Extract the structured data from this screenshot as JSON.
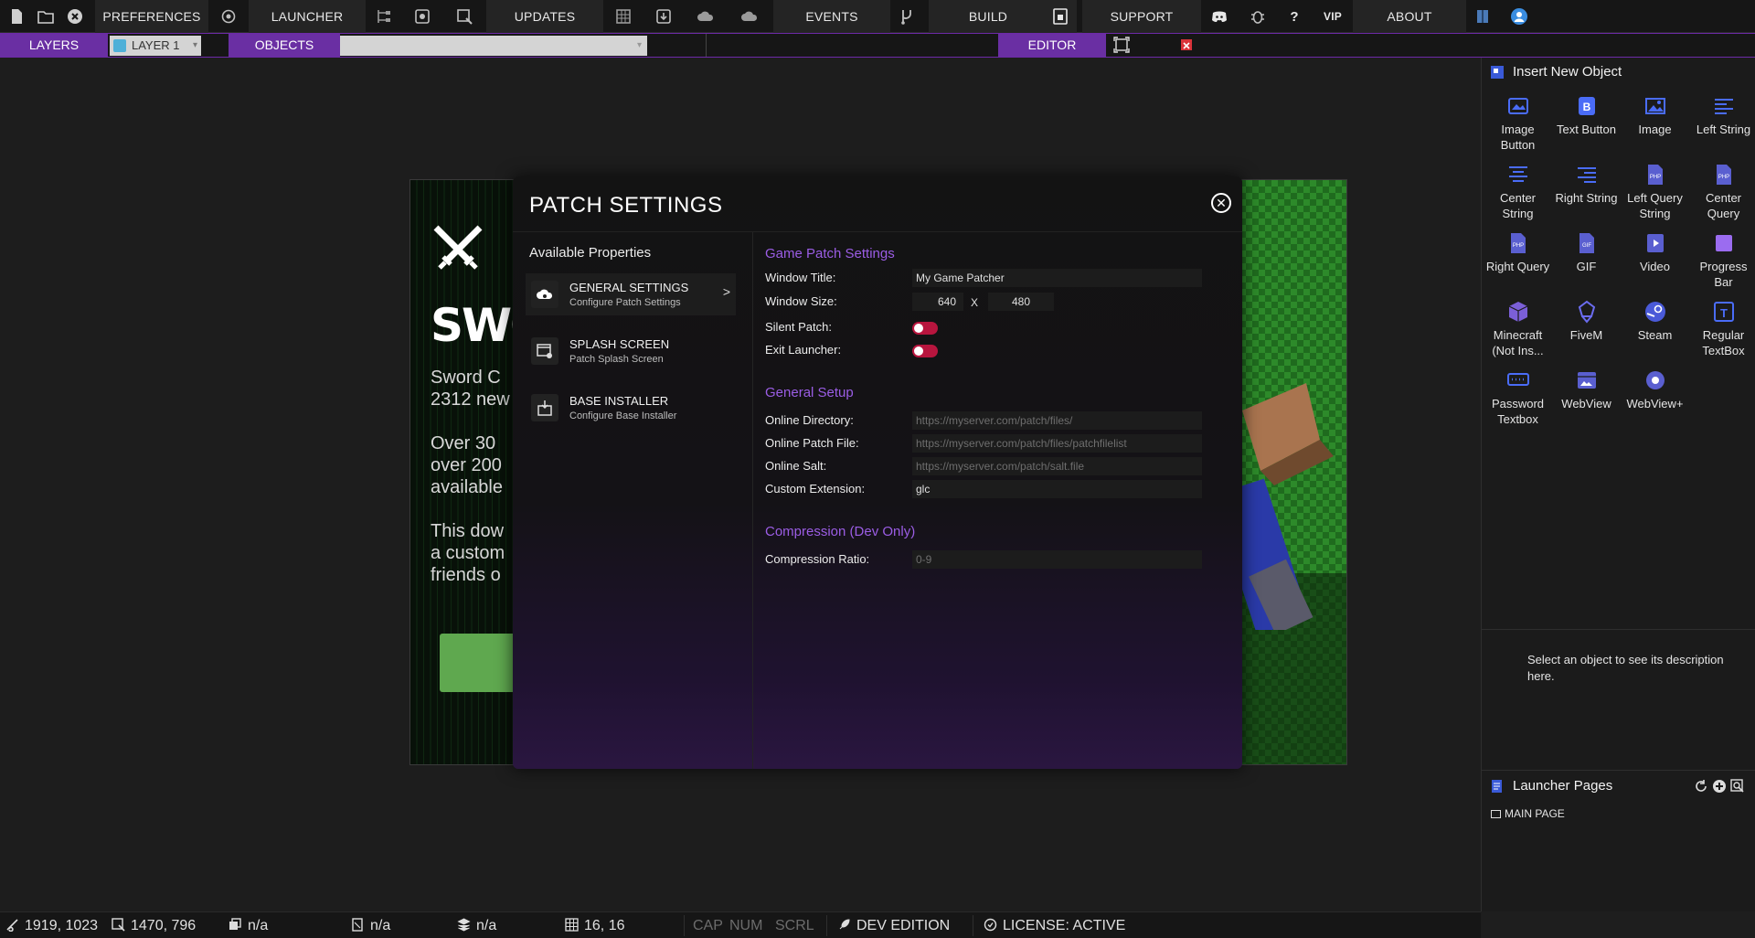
{
  "toolbar": {
    "preferences": "PREFERENCES",
    "launcher": "LAUNCHER",
    "updates": "UPDATES",
    "events": "EVENTS",
    "build": "BUILD",
    "support": "SUPPORT",
    "vip": "VIP",
    "about": "ABOUT"
  },
  "subbar": {
    "layers_tab": "LAYERS",
    "layer_select": "LAYER 1",
    "objects_tab": "OBJECTS",
    "editor_tab": "EDITOR"
  },
  "preview": {
    "title": "SWO",
    "line1": "Sword C",
    "line2": "2312 new",
    "line3": "Over 30",
    "line4": "over 200",
    "line5": "available",
    "line6": "This dow",
    "line7": "a custom",
    "line8": "friends o"
  },
  "dialog": {
    "title": "PATCH SETTINGS",
    "available_properties": "Available Properties",
    "properties": [
      {
        "title": "GENERAL SETTINGS",
        "subtitle": "Configure Patch Settings"
      },
      {
        "title": "SPLASH SCREEN",
        "subtitle": "Patch Splash Screen"
      },
      {
        "title": "BASE INSTALLER",
        "subtitle": "Configure Base Installer"
      }
    ],
    "active_chevron": ">",
    "section_game_patch": "Game Patch Settings",
    "window_title_label": "Window Title:",
    "window_title_value": "My Game Patcher",
    "window_size_label": "Window Size:",
    "window_width": "640",
    "window_size_x": "X",
    "window_height": "480",
    "silent_patch_label": "Silent Patch:",
    "exit_launcher_label": "Exit Launcher:",
    "section_general_setup": "General Setup",
    "online_directory_label": "Online Directory:",
    "online_directory_placeholder": "https://myserver.com/patch/files/",
    "online_patch_file_label": "Online Patch File:",
    "online_patch_file_placeholder": "https://myserver.com/patch/files/patchfilelist",
    "online_salt_label": "Online Salt:",
    "online_salt_placeholder": "https://myserver.com/patch/salt.file",
    "custom_extension_label": "Custom Extension:",
    "custom_extension_value": "glc",
    "section_compression": "Compression (Dev Only)",
    "compression_ratio_label": "Compression Ratio:",
    "compression_ratio_placeholder": "0-9"
  },
  "insert_panel": {
    "title": "Insert New Object",
    "objects": [
      {
        "label": "Image Button",
        "icon": "image-button-icon"
      },
      {
        "label": "Text Button",
        "icon": "text-button-icon"
      },
      {
        "label": "Image",
        "icon": "image-icon"
      },
      {
        "label": "Left String",
        "icon": "left-string-icon"
      },
      {
        "label": "Center String",
        "icon": "center-string-icon"
      },
      {
        "label": "Right String",
        "icon": "right-string-icon"
      },
      {
        "label": "Left Query String",
        "icon": "php-icon"
      },
      {
        "label": "Center Query",
        "icon": "php-icon"
      },
      {
        "label": "Right Query",
        "icon": "php-icon"
      },
      {
        "label": "GIF",
        "icon": "gif-icon"
      },
      {
        "label": "Video",
        "icon": "video-icon"
      },
      {
        "label": "Progress Bar",
        "icon": "progress-bar-icon"
      },
      {
        "label": "Minecraft (Not Ins...",
        "icon": "minecraft-icon"
      },
      {
        "label": "FiveM",
        "icon": "fivem-icon"
      },
      {
        "label": "Steam",
        "icon": "steam-icon"
      },
      {
        "label": "Regular TextBox",
        "icon": "textbox-icon"
      },
      {
        "label": "Password Textbox",
        "icon": "password-icon"
      },
      {
        "label": "WebView",
        "icon": "webview-icon"
      },
      {
        "label": "WebView+",
        "icon": "webview-plus-icon"
      }
    ],
    "description": "Select an object to see its description here."
  },
  "pages_panel": {
    "title": "Launcher Pages",
    "main_page": "MAIN PAGE"
  },
  "statusbar": {
    "cursor": "1919, 1023",
    "canvas_size": "1470, 796",
    "layer_value": "n/a",
    "object_value": "n/a",
    "stack_value": "n/a",
    "grid": "16, 16",
    "cap": "CAP",
    "num": "NUM",
    "scrl": "SCRL",
    "edition": "DEV EDITION",
    "license": "LICENSE: ACTIVE"
  },
  "colors": {
    "accent": "#6a2fa3",
    "section_heading": "#9b5de5",
    "toggle": "#b8153e",
    "icon_blue": "#4a6cf7"
  }
}
